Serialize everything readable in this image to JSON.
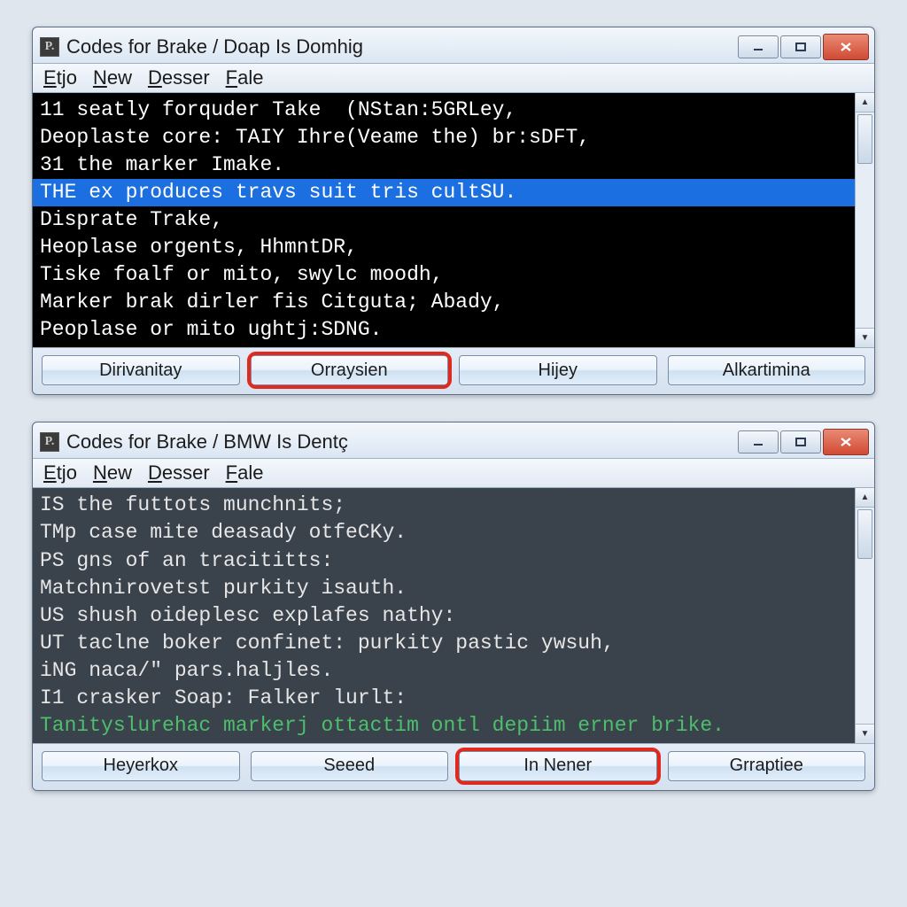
{
  "windows": [
    {
      "app_icon_letter": "P.",
      "title": "Codes for Brake / Doap Is Domhig",
      "menu": [
        "Etjo",
        "New",
        "Desser",
        "Fale"
      ],
      "console_style": "dark",
      "lines": [
        {
          "text": "11 seatly forquder Take  (NStan:5GRLey,",
          "selected": false
        },
        {
          "text": "Deoplaste core: TAIY Ihre(Veame the) br:sDFT,",
          "selected": false
        },
        {
          "text": "31 the marker Imake.",
          "selected": false
        },
        {
          "text": "THE ex produces travs suit tris cultSU.",
          "selected": true
        },
        {
          "text": "Disprate Trake,",
          "selected": false
        },
        {
          "text": "Heoplase orgents, HhmntDR,",
          "selected": false
        },
        {
          "text": "Tiske foalf or mito, swylc moodh,",
          "selected": false
        },
        {
          "text": "Marker brak dirler fis Citguta; Abady,",
          "selected": false
        },
        {
          "text": "Peoplase or mito ughtj:SDNG.",
          "selected": false
        }
      ],
      "buttons": [
        {
          "label": "Dirivanitay",
          "highlighted": false
        },
        {
          "label": "Orraysien",
          "highlighted": true
        },
        {
          "label": "Hijey",
          "highlighted": false
        },
        {
          "label": "Alkartimina",
          "highlighted": false
        }
      ]
    },
    {
      "app_icon_letter": "P.",
      "title": "Codes for Brake / BMW Is Dentç",
      "menu": [
        "Etjo",
        "New",
        "Desser",
        "Fale"
      ],
      "console_style": "slate",
      "lines": [
        {
          "text": "IS the futtots munchnits;",
          "selected": false
        },
        {
          "text": "TMp case mite deasady otfeCKy.",
          "selected": false
        },
        {
          "text": "PS gns of an tracititts:",
          "selected": false
        },
        {
          "text": "Matchnirovetst purkity isauth.",
          "selected": false
        },
        {
          "text": "US shush oideplesc explafes nathy:",
          "selected": false
        },
        {
          "text": "UT taclne boker confinet: purkity pastic ywsuh,",
          "selected": false
        },
        {
          "text": "iNG naca/\" pars.haljles.",
          "selected": false
        },
        {
          "text": "I1 crasker Soap: Falker lurlt:",
          "selected": false
        },
        {
          "text": "Tanityslurehac markerj ottactim ontl depiim erner brike.",
          "green": true
        }
      ],
      "buttons": [
        {
          "label": "Heyerkox",
          "highlighted": false
        },
        {
          "label": "Seeed",
          "highlighted": false
        },
        {
          "label": "In Nener",
          "highlighted": true
        },
        {
          "label": "Grraptiee",
          "highlighted": false
        }
      ]
    }
  ]
}
